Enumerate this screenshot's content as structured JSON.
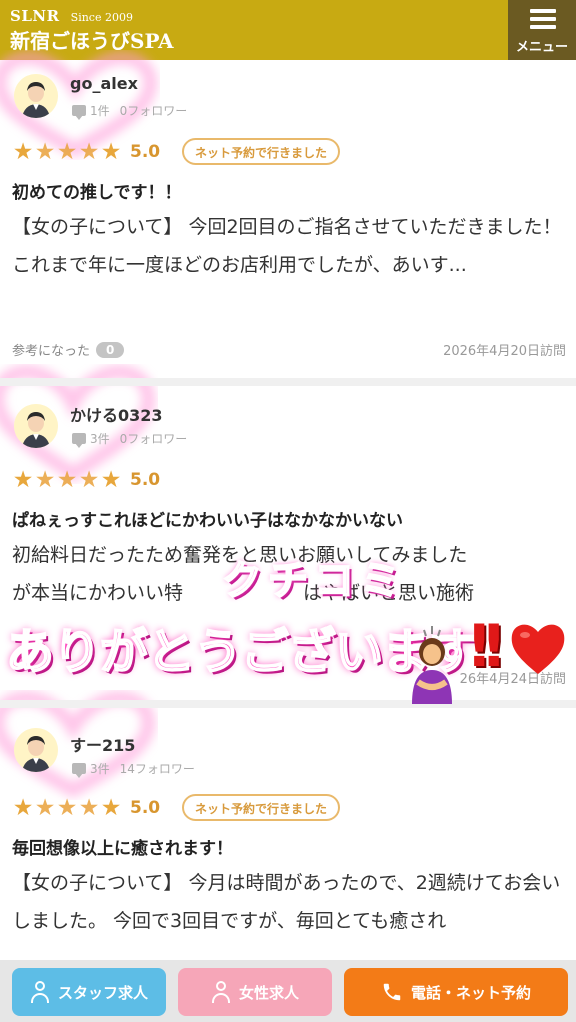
{
  "header": {
    "brand": "SLNR",
    "since": "Since 2009",
    "shop_name": "新宿ごほうびSPA",
    "menu_label": "メニュー"
  },
  "reviews": [
    {
      "user_name": "go_alex",
      "review_count": "1件",
      "followers": "0フォロワー",
      "stars": 5,
      "score": "5.0",
      "badge": "ネット予約で行きました",
      "title": "初めての推しです！！",
      "body": "【女の子について】 今回2回目のご指名させていただきました！ これまで年に一度ほどのお店利用でしたが、あいす...",
      "helpful_label": "参考になった",
      "helpful_count": "0",
      "visit_date": "2026年4月20日訪問"
    },
    {
      "user_name": "かける0323",
      "review_count": "3件",
      "followers": "0フォロワー",
      "stars": 5,
      "score": "5.0",
      "title": "ぱねぇっすこれほどにかわいい子はなかなかいない",
      "body_line1": "初給料日だったため奮発をと思いお願いしてみました",
      "body_line2": "が本当にかわいい特",
      "body_line2b": "はやばいと思い施術",
      "visit_date_partial": "26年4月24日訪問"
    },
    {
      "user_name": "すー215",
      "review_count": "3件",
      "followers": "14フォロワー",
      "stars": 5,
      "score": "5.0",
      "badge": "ネット予約で行きました",
      "title": "毎回想像以上に癒されます！",
      "body": "【女の子について】 今月は時間があったので、2週続けてお会いしました。 今回で3回目ですが、毎回とても癒され"
    }
  ],
  "overlay": {
    "small": "クチコミ",
    "big": "ありがとうございます",
    "exclaim": "!!"
  },
  "bottom_bar": {
    "staff": "スタッフ求人",
    "female": "女性求人",
    "phone": "電話・ネット予約"
  },
  "colors": {
    "header": "#c8aa12",
    "menu": "#6b5a22",
    "star": "#e8a73c",
    "staff_button": "#5dbde6",
    "female_button": "#f6a6b8",
    "phone_button": "#f37b17"
  }
}
